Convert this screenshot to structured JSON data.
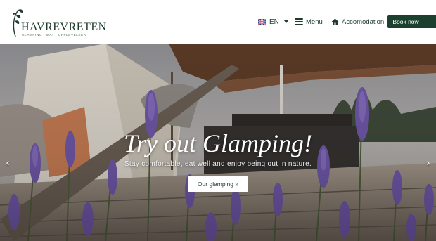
{
  "brand": {
    "name": "HAVREVRETEN",
    "tagline": "GLAMPING · MAT · UPPLEVELSER"
  },
  "nav": {
    "language": "EN",
    "menu_label": "Menu",
    "accommodation_label": "Accomodation",
    "book_label": "Book now"
  },
  "hero": {
    "title": "Try out Glamping!",
    "subtitle": "Stay comfortable, eat well and enjoy being out in nature.",
    "cta_label": "Our glamping »",
    "prev_glyph": "‹",
    "next_glyph": "›"
  },
  "colors": {
    "brand_green": "#1b4030",
    "text_dark": "#1d3a2a",
    "lavender": "#7b5fb0"
  },
  "icons": [
    "leaf-logo-icon",
    "uk-flag-icon",
    "caret-down-icon",
    "hamburger-icon",
    "home-icon",
    "chevron-left-icon",
    "chevron-right-icon"
  ]
}
